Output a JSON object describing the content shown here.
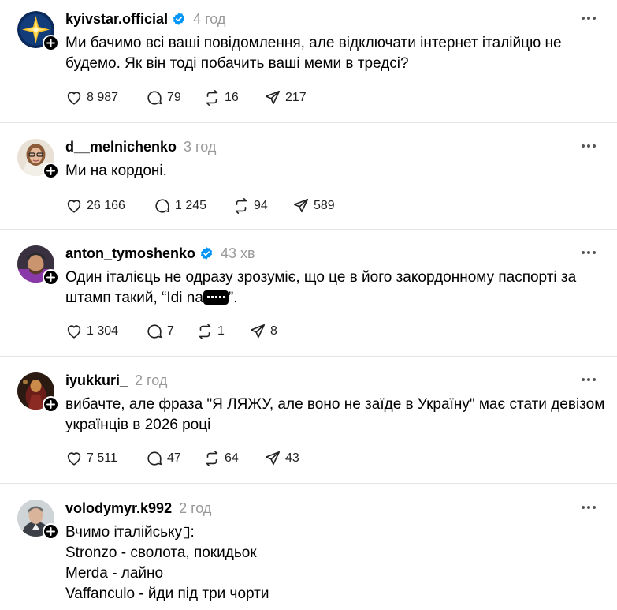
{
  "posts": [
    {
      "username": "kyivstar.official",
      "verified": true,
      "time": "4 год",
      "lines": [
        "Ми бачимо всі ваші повідомлення, але відключати інтернет італійцю не",
        "будемо. Як він тоді побачить ваші меми в тредсі?"
      ],
      "likes": "8 987",
      "replies": "79",
      "reposts": "16",
      "shares": "217",
      "avatar": "kyivstar-logo"
    },
    {
      "username": "d__melnichenko",
      "verified": false,
      "time": "3 год",
      "lines": [
        "Ми на кордоні."
      ],
      "likes": "26 166",
      "replies": "1 245",
      "reposts": "94",
      "shares": "589",
      "avatar": "woman-glasses-photo"
    },
    {
      "username": "anton_tymoshenko",
      "verified": true,
      "time": "43 хв",
      "lines": [
        "Один італієць не одразу зрозуміє, що це в його закордонному паспорті за",
        "штамп такий, “Idi na"
      ],
      "line_tail": "”.",
      "likes": "1 304",
      "replies": "7",
      "reposts": "1",
      "shares": "8",
      "avatar": "man-cap-photo"
    },
    {
      "username": "iyukkuri_",
      "verified": false,
      "time": "2 год",
      "lines": [
        "вибачте, але фраза \"Я ЛЯЖУ, але воно не заїде в Україну\" має стати девізом",
        "українців в 2026 році"
      ],
      "likes": "7 511",
      "replies": "47",
      "reposts": "64",
      "shares": "43",
      "avatar": "dark-red-photo"
    },
    {
      "username": "volodymyr.k992",
      "verified": false,
      "time": "2 год",
      "lines": [
        "Вчимо італійську▯:",
        "Stronzo - сволота, покидьок",
        "Merda - лайно",
        "Vaffanculo - йди під три чорти"
      ],
      "avatar": "man-portrait-photo"
    }
  ],
  "icons": {
    "like": "heart-icon",
    "reply": "comment-icon",
    "repost": "repost-icon",
    "share": "send-icon",
    "more": "more-icon",
    "follow": "plus-icon",
    "verified": "verified-badge-icon"
  },
  "colors": {
    "verified": "#0095f6",
    "meta": "#999999",
    "divider": "#e5e5e5"
  }
}
